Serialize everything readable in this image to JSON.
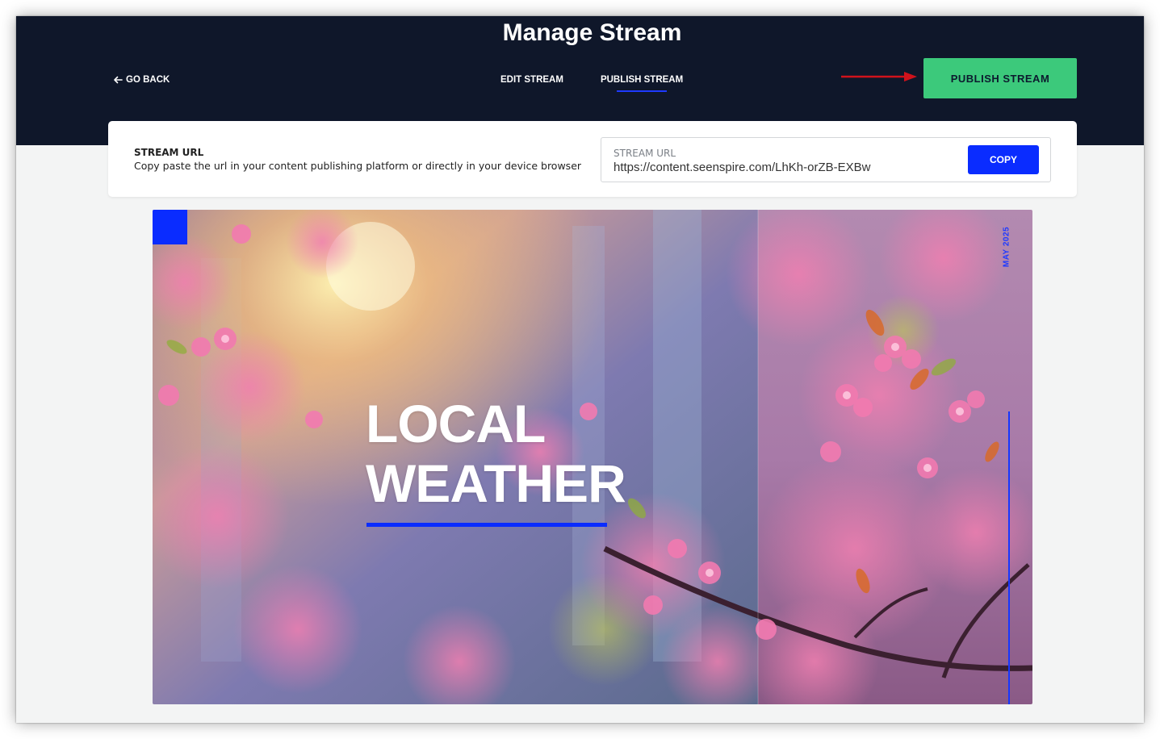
{
  "header": {
    "title": "Manage Stream",
    "go_back": "GO BACK",
    "tabs": [
      {
        "label": "EDIT STREAM",
        "active": false
      },
      {
        "label": "PUBLISH STREAM",
        "active": true
      }
    ],
    "publish_button": "PUBLISH STREAM"
  },
  "stream_url": {
    "title": "STREAM URL",
    "description": "Copy paste the url in your content publishing platform or directly in your device browser",
    "field_label": "STREAM URL",
    "value": "https://content.seenspire.com/LhKh-orZB-EXBw",
    "copy_button": "COPY"
  },
  "preview": {
    "headline_line1": "LOCAL",
    "headline_line2": "WEATHER",
    "date": "MAY 2025"
  },
  "colors": {
    "header_bg": "#0f172a",
    "publish_green": "#3cc97b",
    "accent_blue": "#0a2cff",
    "annotation_arrow": "#d0121b"
  }
}
